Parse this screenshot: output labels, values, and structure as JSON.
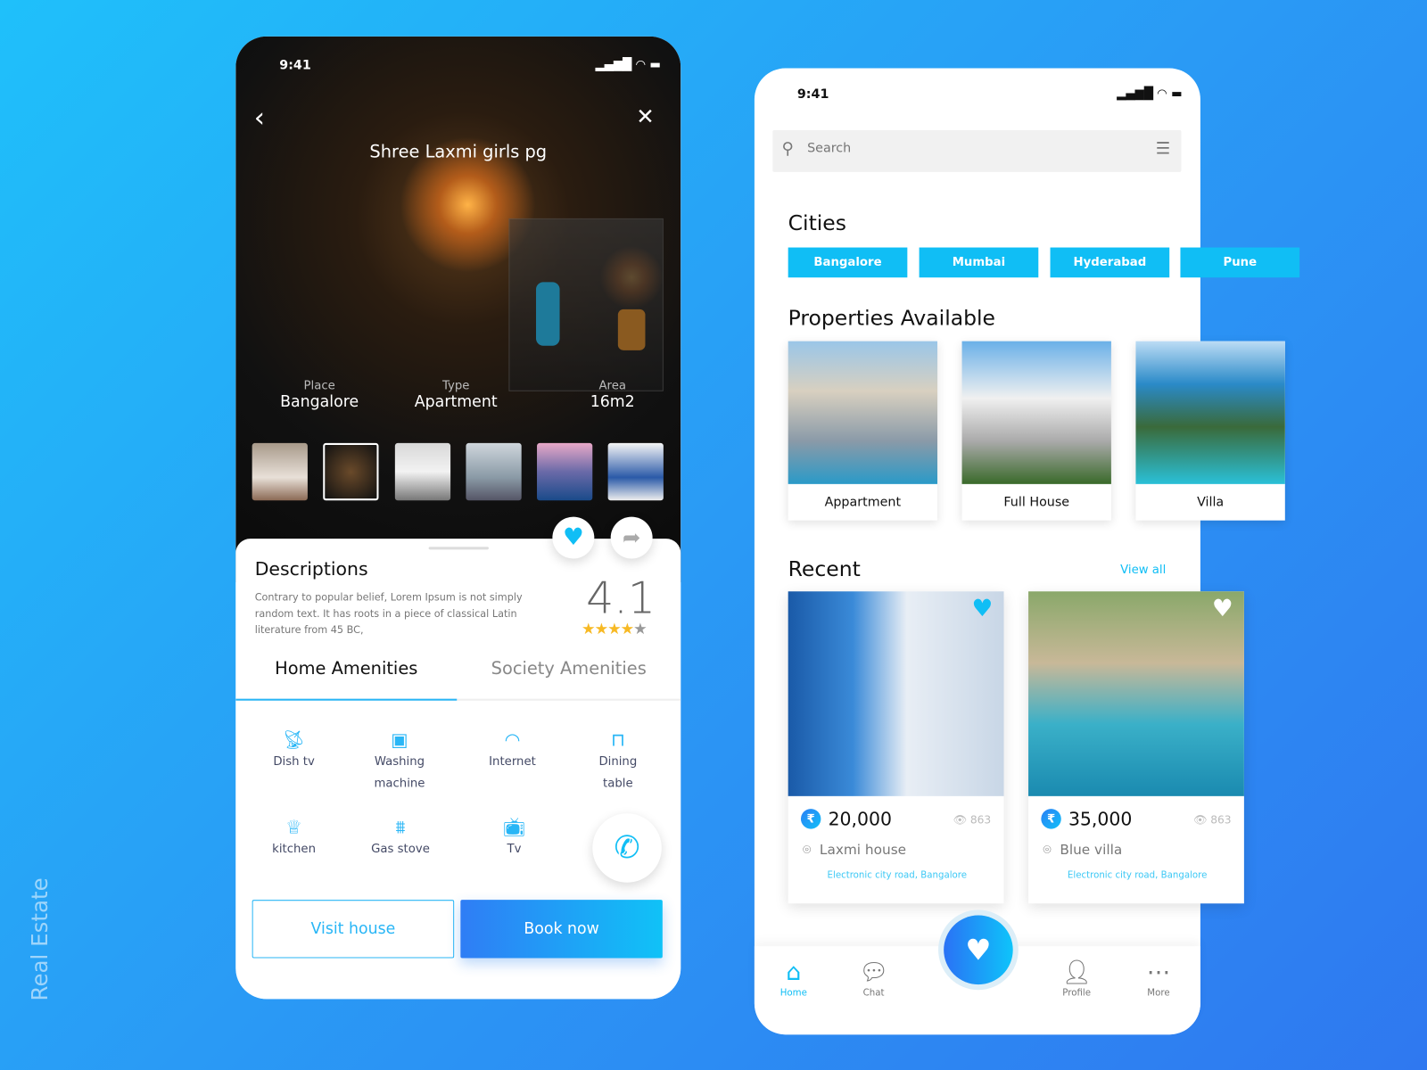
{
  "side_label": "Real Estate",
  "colors": {
    "accent": "#10bef5",
    "button_gradient": [
      "#2f7df5",
      "#10c2f7"
    ],
    "star": "#f7b924"
  },
  "detail": {
    "status_time": "9:41",
    "title": "Shree Laxmi girls pg",
    "back_icon": "chevron-left-icon",
    "view360_icon": "360-view-icon",
    "meta": [
      {
        "label": "Place",
        "value": "Bangalore"
      },
      {
        "label": "Type",
        "value": "Apartment"
      },
      {
        "label": "Area",
        "value": "16m2"
      }
    ],
    "thumbnails": [
      "bedroom",
      "dark-interior",
      "bathroom",
      "living-room",
      "pool-sunset",
      "blue-room"
    ],
    "selected_thumbnail": 1,
    "favorite_icon": "heart-icon",
    "share_icon": "share-icon",
    "desc_title": "Descriptions",
    "desc_text": "Contrary to popular belief, Lorem Ipsum is not simply random text. It has roots in a piece of classical Latin literature from 45 BC,",
    "rating": "4.1",
    "rating_stars": 4,
    "rating_max": 5,
    "tabs": [
      {
        "label": "Home Amenities",
        "active": true
      },
      {
        "label": "Society Amenities",
        "active": false
      }
    ],
    "amenities": [
      {
        "label": "Dish tv",
        "icon": "satellite-dish-icon"
      },
      {
        "label": "Washing machine",
        "icon": "washing-machine-icon"
      },
      {
        "label": "Internet",
        "icon": "wifi-icon"
      },
      {
        "label": "Dining table",
        "icon": "dining-table-icon"
      },
      {
        "label": "kitchen",
        "icon": "chef-hat-icon"
      },
      {
        "label": "Gas stove",
        "icon": "gas-stove-icon"
      },
      {
        "label": "Tv",
        "icon": "tv-icon"
      }
    ],
    "call_icon": "phone-icon",
    "visit_label": "Visit house",
    "book_label": "Book now"
  },
  "home": {
    "status_time": "9:41",
    "search_placeholder": "Search",
    "cities_title": "Cities",
    "cities": [
      "Bangalore",
      "Mumbai",
      "Hyderabad",
      "Pune"
    ],
    "properties_title": "Properties Available",
    "properties": [
      {
        "label": "Appartment"
      },
      {
        "label": "Full House"
      },
      {
        "label": "Villa"
      }
    ],
    "recent_title": "Recent",
    "view_all": "View all",
    "recent": [
      {
        "price": "20,000",
        "views": "863",
        "name": "Laxmi house",
        "address": "Electronic city road, Bangalore",
        "favorited": true
      },
      {
        "price": "35,000",
        "views": "863",
        "name": "Blue villa",
        "address": "Electronic city road, Bangalore",
        "favorited": false
      }
    ],
    "nav": [
      {
        "label": "Home",
        "icon": "home-icon",
        "active": true
      },
      {
        "label": "Chat",
        "icon": "chat-icon"
      },
      {
        "label": "Profile",
        "icon": "profile-icon"
      },
      {
        "label": "More",
        "icon": "more-icon"
      }
    ],
    "fab_icon": "heart-icon"
  }
}
